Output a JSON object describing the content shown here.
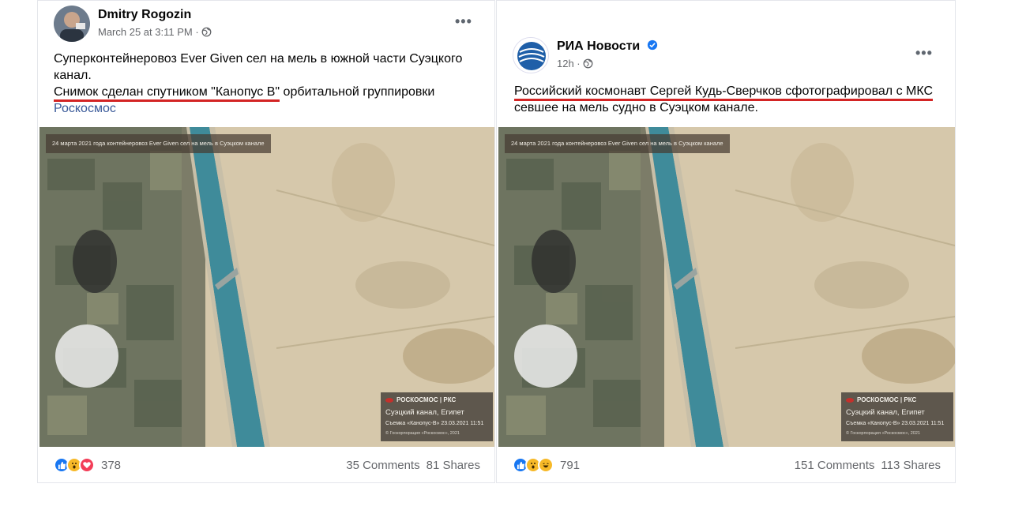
{
  "posts": [
    {
      "author": "Dmitry Rogozin",
      "timestamp": "March 25 at 3:11 PM ·",
      "text_line1": "Суперконтейнеровоз Ever Given сел на мель в южной части Суэцкого канал.",
      "text_line2_underlined": "Снимок сделан спутником \"Канопус В\"",
      "text_line2_rest": " орбитальной группировки",
      "link": "Роскосмос",
      "image_caption": "24 марта 2021 года контейнеровоз Ever Given сел на мель в Суэцком канале",
      "credit_brand": "РОСКОСМОС | РКС",
      "credit_place": "Суэцкий канал, Египет",
      "credit_date": "Съемка «Канопус-В» 23.03.2021 11:51",
      "credit_small": "© Госкорпорация «Роскосмос», 2021",
      "reaction_count": "378",
      "comments": "35 Comments",
      "shares": "81 Shares"
    },
    {
      "author": "РИА Новости",
      "timestamp": "12h ·",
      "text_line1_underlined": "Российский космонавт Сергей Кудь-Сверчков сфотографировал с МКС",
      "text_line2": "севшее на мель судно в Суэцком канале.",
      "image_caption": "24 марта 2021 года контейнеровоз Ever Given сел на мель в Суэцком канале",
      "credit_brand": "РОСКОСМОС | РКС",
      "credit_place": "Суэцкий канал, Египет",
      "credit_date": "Съемка «Канопус-В» 23.03.2021 11:51",
      "credit_small": "© Госкорпорация «Роскосмос», 2021",
      "reaction_count": "791",
      "comments": "151 Comments",
      "shares": "113 Shares"
    }
  ],
  "colors": {
    "link": "#385898",
    "underline": "#d32424",
    "secondary_text": "#65676b",
    "canal": "#3f8b9a"
  }
}
